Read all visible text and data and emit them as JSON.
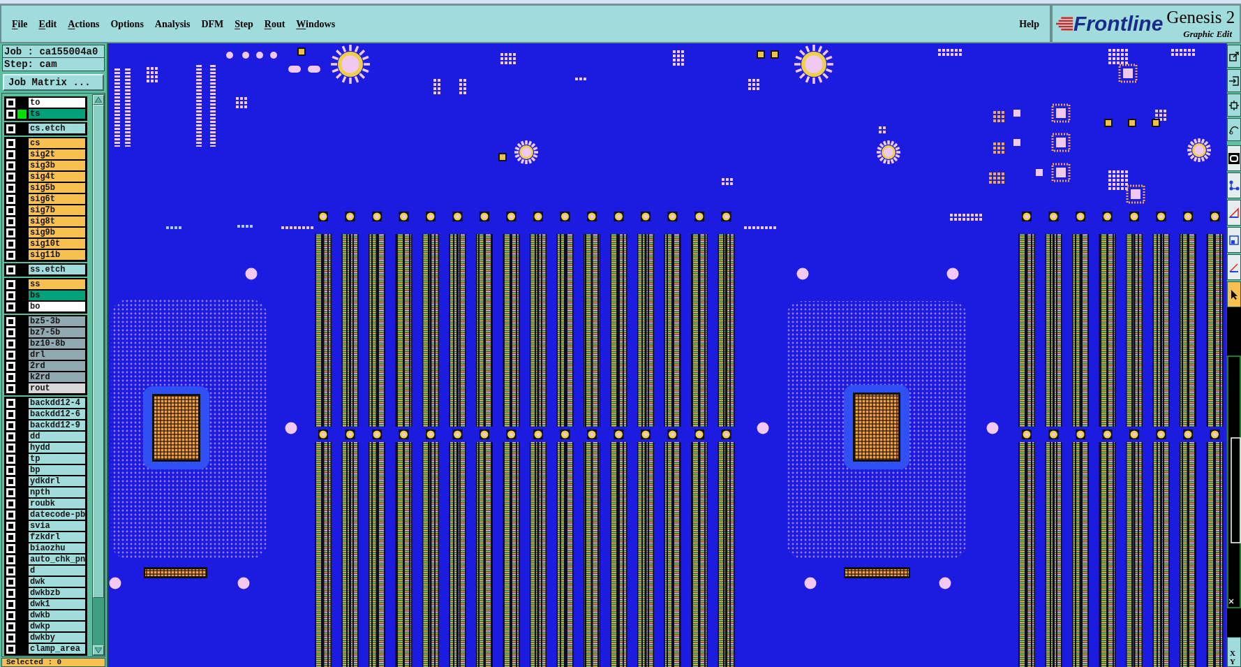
{
  "window": {
    "menu_bar": {
      "items": [
        {
          "label": "File",
          "underline_first": true
        },
        {
          "label": "Edit",
          "underline_first": true
        },
        {
          "label": "Actions",
          "underline_first": true
        },
        {
          "label": "Options",
          "underline_first": false
        },
        {
          "label": "Analysis",
          "underline_first": false
        },
        {
          "label": "DFM",
          "underline_first": false
        },
        {
          "label": "Step",
          "underline_first": true
        },
        {
          "label": "Rout",
          "underline_first": true
        },
        {
          "label": "Windows",
          "underline_first": true
        }
      ],
      "help": {
        "label": "Help"
      }
    },
    "logo": {
      "brand": "Frontline",
      "product": "Genesis 2",
      "subtitle": "Graphic Edit"
    }
  },
  "left_panel": {
    "job": "Job : ca155004a0",
    "step": "Step: cam",
    "job_matrix_button": "Job Matrix ...",
    "layer_groups": [
      {
        "layers": [
          {
            "name": "to",
            "color": "#ffffff",
            "checked": false,
            "displayed": false
          },
          {
            "name": "ts",
            "color": "#00a078",
            "checked": false,
            "displayed": true
          }
        ]
      },
      {
        "layers": [
          {
            "name": "cs.etch",
            "color": "#a0dcdc",
            "checked": false,
            "displayed": false
          }
        ]
      },
      {
        "layers": [
          {
            "name": "cs",
            "color": "#f8c050",
            "checked": false,
            "displayed": false
          },
          {
            "name": "sig2t",
            "color": "#f8c050",
            "checked": false,
            "displayed": false
          },
          {
            "name": "sig3b",
            "color": "#f8c050",
            "checked": false,
            "displayed": false
          },
          {
            "name": "sig4t",
            "color": "#f8c050",
            "checked": false,
            "displayed": false
          },
          {
            "name": "sig5b",
            "color": "#f8c050",
            "checked": false,
            "displayed": false
          },
          {
            "name": "sig6t",
            "color": "#f8c050",
            "checked": false,
            "displayed": false
          },
          {
            "name": "sig7b",
            "color": "#f8c050",
            "checked": false,
            "displayed": false
          },
          {
            "name": "sig8t",
            "color": "#f8c050",
            "checked": false,
            "displayed": false
          },
          {
            "name": "sig9b",
            "color": "#f8c050",
            "checked": false,
            "displayed": false
          },
          {
            "name": "sig10t",
            "color": "#f8c050",
            "checked": false,
            "displayed": false
          },
          {
            "name": "sig11b",
            "color": "#f8c050",
            "checked": false,
            "displayed": false
          }
        ]
      },
      {
        "layers": [
          {
            "name": "ss.etch",
            "color": "#a0dcdc",
            "checked": false,
            "displayed": false
          }
        ]
      },
      {
        "layers": [
          {
            "name": "ss",
            "color": "#f8c050",
            "checked": false,
            "displayed": false
          },
          {
            "name": "bs",
            "color": "#00a078",
            "checked": false,
            "displayed": false
          },
          {
            "name": "bo",
            "color": "#ffffff",
            "checked": false,
            "displayed": false
          }
        ]
      },
      {
        "layers": [
          {
            "name": "bz5-3b",
            "color": "#90a8b0",
            "checked": false,
            "displayed": false
          },
          {
            "name": "bz7-5b",
            "color": "#90a8b0",
            "checked": false,
            "displayed": false
          },
          {
            "name": "bz10-8b",
            "color": "#90a8b0",
            "checked": false,
            "displayed": false
          },
          {
            "name": "drl",
            "color": "#90a8b0",
            "checked": false,
            "displayed": false
          },
          {
            "name": "2rd",
            "color": "#90a8b0",
            "checked": false,
            "displayed": false
          },
          {
            "name": "k2rd",
            "color": "#90a8b0",
            "checked": false,
            "displayed": false
          },
          {
            "name": "rout",
            "color": "#d8d8d8",
            "checked": false,
            "displayed": false
          }
        ]
      },
      {
        "layers": [
          {
            "name": "backdd12-4",
            "color": "#a0dcdc",
            "checked": false,
            "displayed": false
          },
          {
            "name": "backdd12-6",
            "color": "#a0dcdc",
            "checked": false,
            "displayed": false
          },
          {
            "name": "backdd12-9",
            "color": "#a0dcdc",
            "checked": false,
            "displayed": false
          },
          {
            "name": "dd",
            "color": "#a0dcdc",
            "checked": false,
            "displayed": false
          },
          {
            "name": "hydd",
            "color": "#a0dcdc",
            "checked": false,
            "displayed": false
          },
          {
            "name": "tp",
            "color": "#a0dcdc",
            "checked": false,
            "displayed": false
          },
          {
            "name": "bp",
            "color": "#a0dcdc",
            "checked": false,
            "displayed": false
          },
          {
            "name": "ydkdrl",
            "color": "#a0dcdc",
            "checked": false,
            "displayed": false
          },
          {
            "name": "npth",
            "color": "#a0dcdc",
            "checked": false,
            "displayed": false
          },
          {
            "name": "roubk",
            "color": "#a0dcdc",
            "checked": false,
            "displayed": false
          },
          {
            "name": "datecode-pb",
            "color": "#a0dcdc",
            "checked": false,
            "displayed": false
          },
          {
            "name": "svia",
            "color": "#a0dcdc",
            "checked": false,
            "displayed": false
          },
          {
            "name": "fzkdrl",
            "color": "#a0dcdc",
            "checked": false,
            "displayed": false
          },
          {
            "name": "biaozhu",
            "color": "#a0dcdc",
            "checked": false,
            "displayed": false
          },
          {
            "name": "auto_chk_pn",
            "color": "#a0dcdc",
            "checked": false,
            "displayed": false
          },
          {
            "name": "d",
            "color": "#a0dcdc",
            "checked": false,
            "displayed": false
          },
          {
            "name": "dwk",
            "color": "#a0dcdc",
            "checked": false,
            "displayed": false
          },
          {
            "name": "dwkbzb",
            "color": "#a0dcdc",
            "checked": false,
            "displayed": false
          },
          {
            "name": "dwk1",
            "color": "#a0dcdc",
            "checked": false,
            "displayed": false
          },
          {
            "name": "dwkb",
            "color": "#a0dcdc",
            "checked": false,
            "displayed": false
          },
          {
            "name": "dwkp",
            "color": "#a0dcdc",
            "checked": false,
            "displayed": false
          },
          {
            "name": "dwkby",
            "color": "#a0dcdc",
            "checked": false,
            "displayed": false
          },
          {
            "name": "clamp_area",
            "color": "#a0dcdc",
            "checked": false,
            "displayed": false
          }
        ]
      }
    ],
    "selected_count": "Selected : 0"
  },
  "right_toolbar": {
    "tools": [
      {
        "kind": "export",
        "selected": false
      },
      {
        "kind": "import",
        "selected": false
      },
      {
        "kind": "transform",
        "selected": false
      },
      {
        "kind": "curve",
        "selected": false
      },
      {
        "kind": "shape",
        "selected": false
      },
      {
        "kind": "nodes",
        "selected": false
      },
      {
        "kind": "measure",
        "selected": false
      },
      {
        "kind": "box",
        "selected": false
      },
      {
        "kind": "angle",
        "selected": false
      },
      {
        "kind": "pointer",
        "selected": true
      }
    ],
    "coordinate_labels": [
      "X",
      "Y"
    ]
  }
}
